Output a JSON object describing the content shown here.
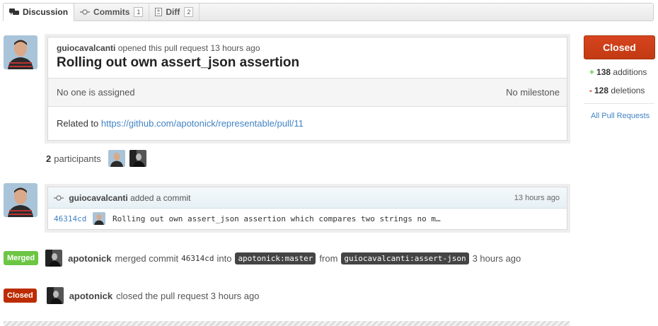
{
  "tabs": [
    {
      "label": "Discussion",
      "icon": "discussion-icon"
    },
    {
      "label": "Commits",
      "icon": "commit-icon",
      "count": "1"
    },
    {
      "label": "Diff",
      "icon": "diff-icon",
      "count": "2"
    }
  ],
  "pr": {
    "author": "guiocavalcanti",
    "opened_text": "opened this pull request 13 hours ago",
    "title": "Rolling out own assert_json assertion",
    "assignee": "No one is assigned",
    "milestone": "No milestone",
    "body_prefix": "Related to",
    "body_link": "https://github.com/apotonick/representable/pull/11"
  },
  "participants": {
    "count": "2",
    "label": "participants"
  },
  "commit_event": {
    "author": "guiocavalcanti",
    "action": "added a commit",
    "time": "13 hours ago",
    "sha": "46314cd",
    "message": "Rolling out own assert_json assertion which compares two strings no m…"
  },
  "merge_event": {
    "label": "Merged",
    "author": "apotonick",
    "text1": "merged commit",
    "sha": "46314cd",
    "text2": "into",
    "target_branch": "apotonick:master",
    "text3": "from",
    "source_branch": "guiocavalcanti:assert-json",
    "time": "3 hours ago"
  },
  "close_event": {
    "label": "Closed",
    "author": "apotonick",
    "text": "closed the pull request 3 hours ago"
  },
  "sidebar": {
    "state": "Closed",
    "additions_count": "138",
    "additions_label": "additions",
    "deletions_count": "128",
    "deletions_label": "deletions",
    "all_prs": "All Pull Requests"
  },
  "colors": {
    "accent_link": "#4183c4",
    "merged": "#6cc644",
    "closed": "#bd2c00"
  }
}
